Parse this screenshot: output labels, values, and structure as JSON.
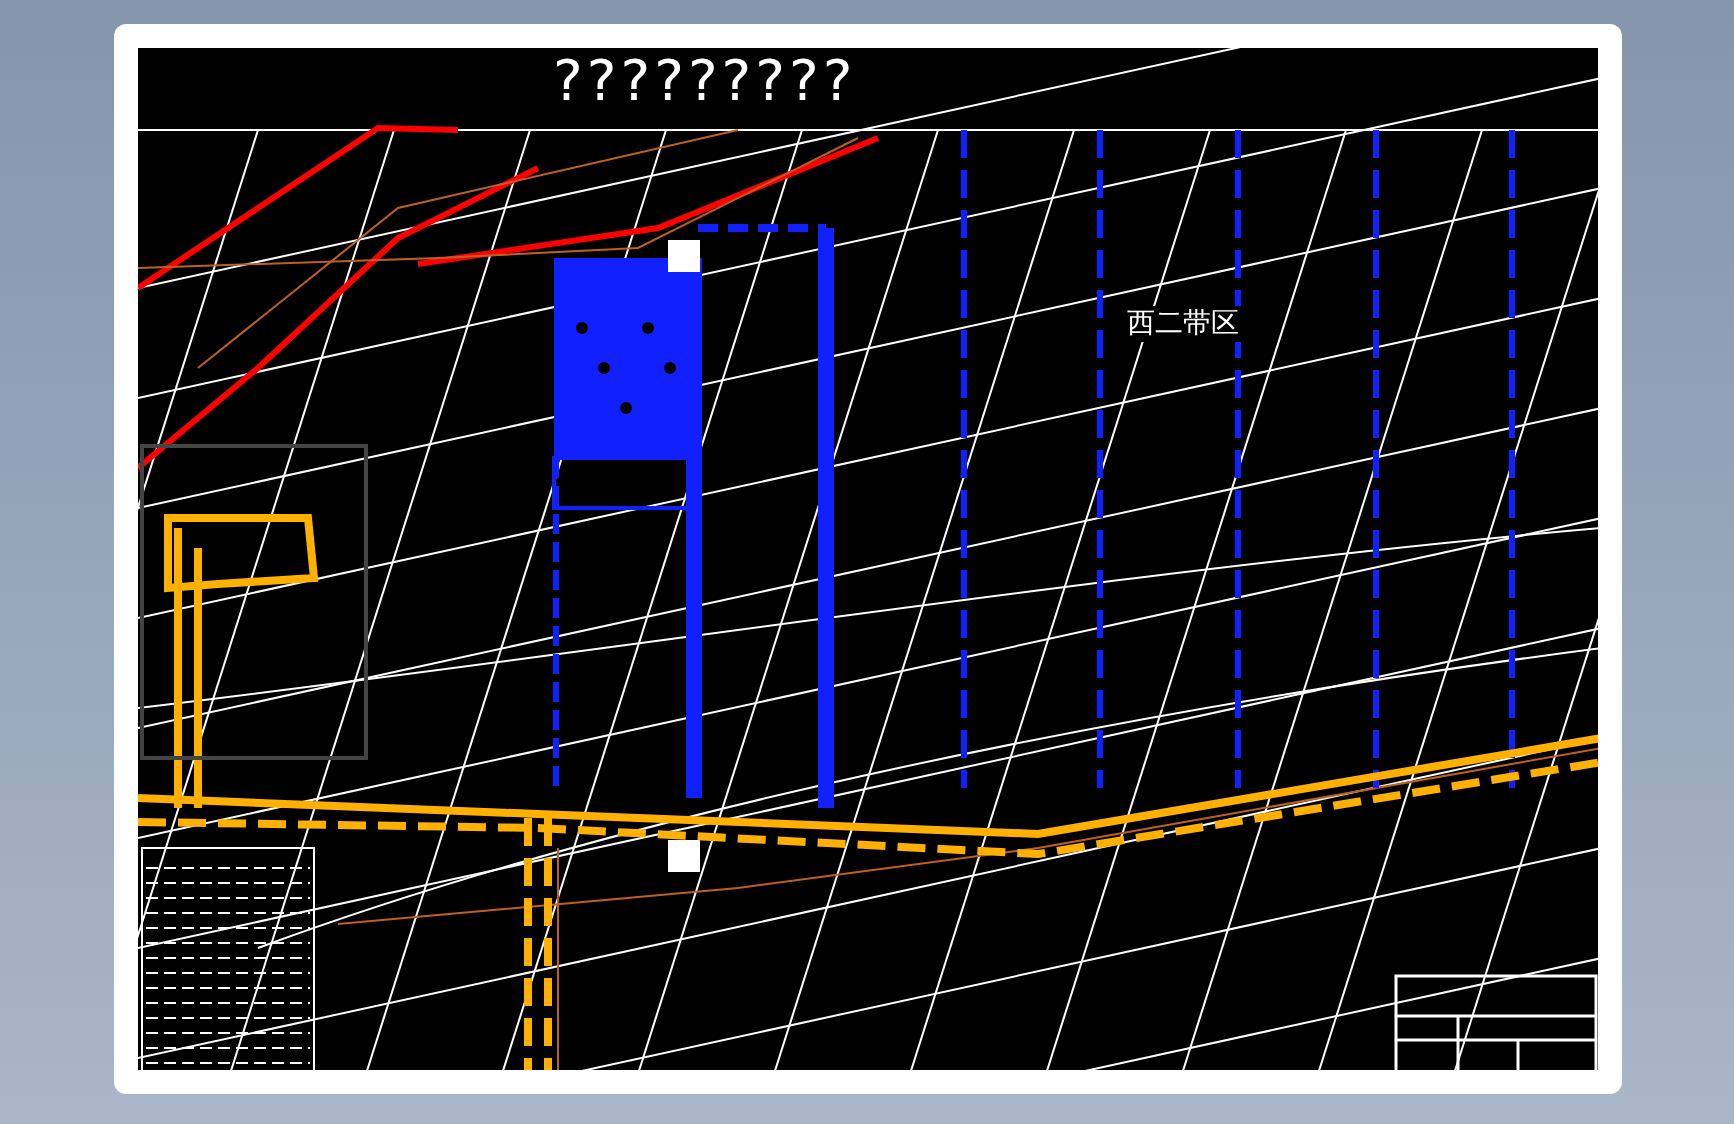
{
  "drawing": {
    "title": "?????????",
    "zone_label": "西二带区"
  }
}
